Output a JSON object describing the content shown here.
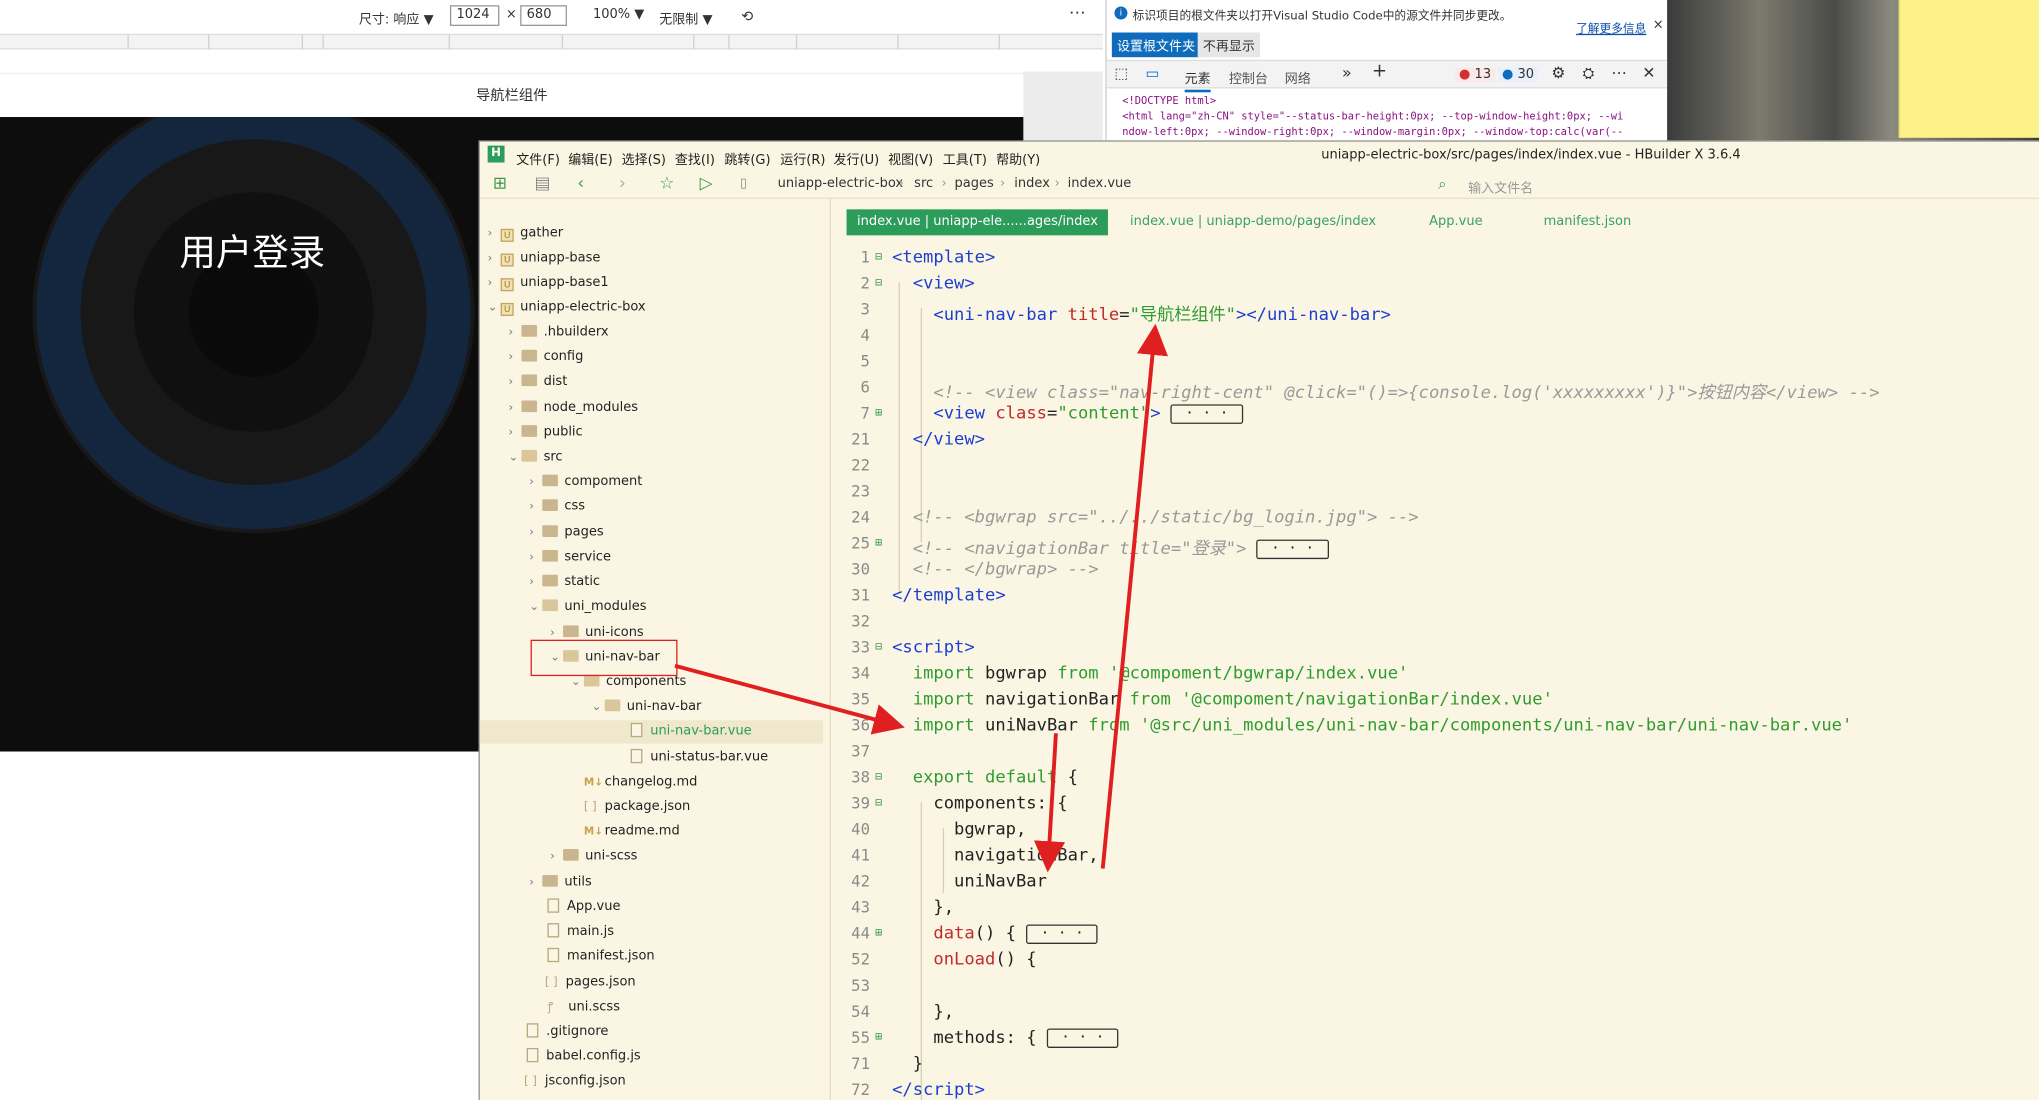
{
  "device_toolbar": {
    "size_label": "尺寸: 响应 ▼",
    "width": "1024",
    "times": "×",
    "height": "680",
    "zoom": "100% ▼",
    "throttle": "无限制 ▼",
    "more": "⋯"
  },
  "preview": {
    "nav_title": "导航栏组件",
    "login_title": "用户登录"
  },
  "devtools": {
    "notice": "标识项目的根文件夹以打开Visual Studio Code中的源文件并同步更改。",
    "learn_more": "了解更多信息",
    "set_root_button": "设置根文件夹",
    "dont_show_button": "不再显示",
    "tabs": [
      "元素",
      "控制台",
      "网络"
    ],
    "error_count": "13",
    "warning_count": "30",
    "src_lines": [
      "<!DOCTYPE html>",
      "<html lang=\"zh-CN\" style=\"--status-bar-height:0px; --top-window-height:0px; --wi",
      "ndow-left:0px; --window-right:0px; --window-margin:0px; --window-top:calc(var(--"
    ]
  },
  "hbuilder": {
    "menu": [
      "文件(F)",
      "编辑(E)",
      "选择(S)",
      "查找(I)",
      "跳转(G)",
      "运行(R)",
      "发行(U)",
      "视图(V)",
      "工具(T)",
      "帮助(Y)"
    ],
    "window_title": "uniapp-electric-box/src/pages/index/index.vue - HBuilder X 3.6.4",
    "breadcrumb": [
      "uniapp-electric-box",
      "src",
      "pages",
      "index",
      "index.vue"
    ],
    "file_search_placeholder": "输入文件名",
    "tabs": [
      "index.vue | uniapp-ele......ages/index",
      "index.vue | uniapp-demo/pages/index",
      "App.vue",
      "manifest.json"
    ],
    "tree": [
      "gather",
      "uniapp-base",
      "uniapp-base1",
      "uniapp-electric-box",
      ".hbuilderx",
      "config",
      "dist",
      "node_modules",
      "public",
      "src",
      "compoment",
      "css",
      "pages",
      "service",
      "static",
      "uni_modules",
      "uni-icons",
      "uni-nav-bar",
      "components",
      "uni-nav-bar",
      "uni-nav-bar.vue",
      "uni-status-bar.vue",
      "changelog.md",
      "package.json",
      "readme.md",
      "uni-scss",
      "utils",
      "App.vue",
      "main.js",
      "manifest.json",
      "pages.json",
      "uni.scss",
      ".gitignore",
      "babel.config.js",
      "jsconfig.json"
    ],
    "line_numbers": [
      "1",
      "2",
      "3",
      "4",
      "5",
      "6",
      "7",
      "21",
      "22",
      "23",
      "24",
      "25",
      "30",
      "31",
      "32",
      "33",
      "34",
      "35",
      "36",
      "37",
      "38",
      "39",
      "40",
      "41",
      "42",
      "43",
      "44",
      "52",
      "53",
      "54",
      "55",
      "71",
      "72"
    ],
    "collapsed": "· · ·"
  },
  "colors": {
    "editor_bg": "#fbf6e4",
    "active_tab": "#2b9c5a",
    "tag": "#1b3fd1",
    "attr": "#c02a2a",
    "string": "#2f9c2f",
    "annotation": "#e02020"
  }
}
